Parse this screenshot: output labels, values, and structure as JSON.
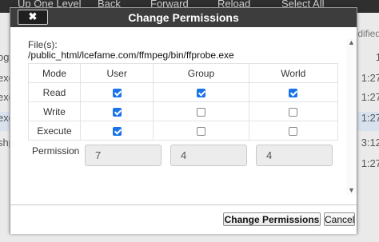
{
  "background": {
    "toolbar": [
      "Up One Level",
      "Back",
      "Forward",
      "Reload",
      "Select All"
    ],
    "right_header": "dified",
    "rows": [
      {
        "left": "og",
        "right": "1"
      },
      {
        "left": "exe",
        "right": "1:27"
      },
      {
        "left": "exe",
        "right": "1:27"
      },
      {
        "left": "exe",
        "right": "1:27"
      },
      {
        "left": "shp",
        "right": "3:12"
      },
      {
        "left": "",
        "right": "1:27"
      }
    ]
  },
  "dialog": {
    "title": "Change Permissions",
    "close_label": "✖",
    "file_label": "File(s):",
    "file_path": "/public_html/lcefame.com/ffmpeg/bin/ffprobe.exe",
    "mode_label": "Mode",
    "columns": [
      "User",
      "Group",
      "World"
    ],
    "rows": [
      {
        "label": "Read",
        "values": [
          true,
          true,
          true
        ]
      },
      {
        "label": "Write",
        "values": [
          true,
          false,
          false
        ]
      },
      {
        "label": "Execute",
        "values": [
          true,
          false,
          false
        ]
      }
    ],
    "permission_label": "Permission",
    "permission_values": [
      "7",
      "4",
      "4"
    ],
    "buttons": {
      "change": "Change Permissions",
      "cancel": "Cancel"
    }
  }
}
